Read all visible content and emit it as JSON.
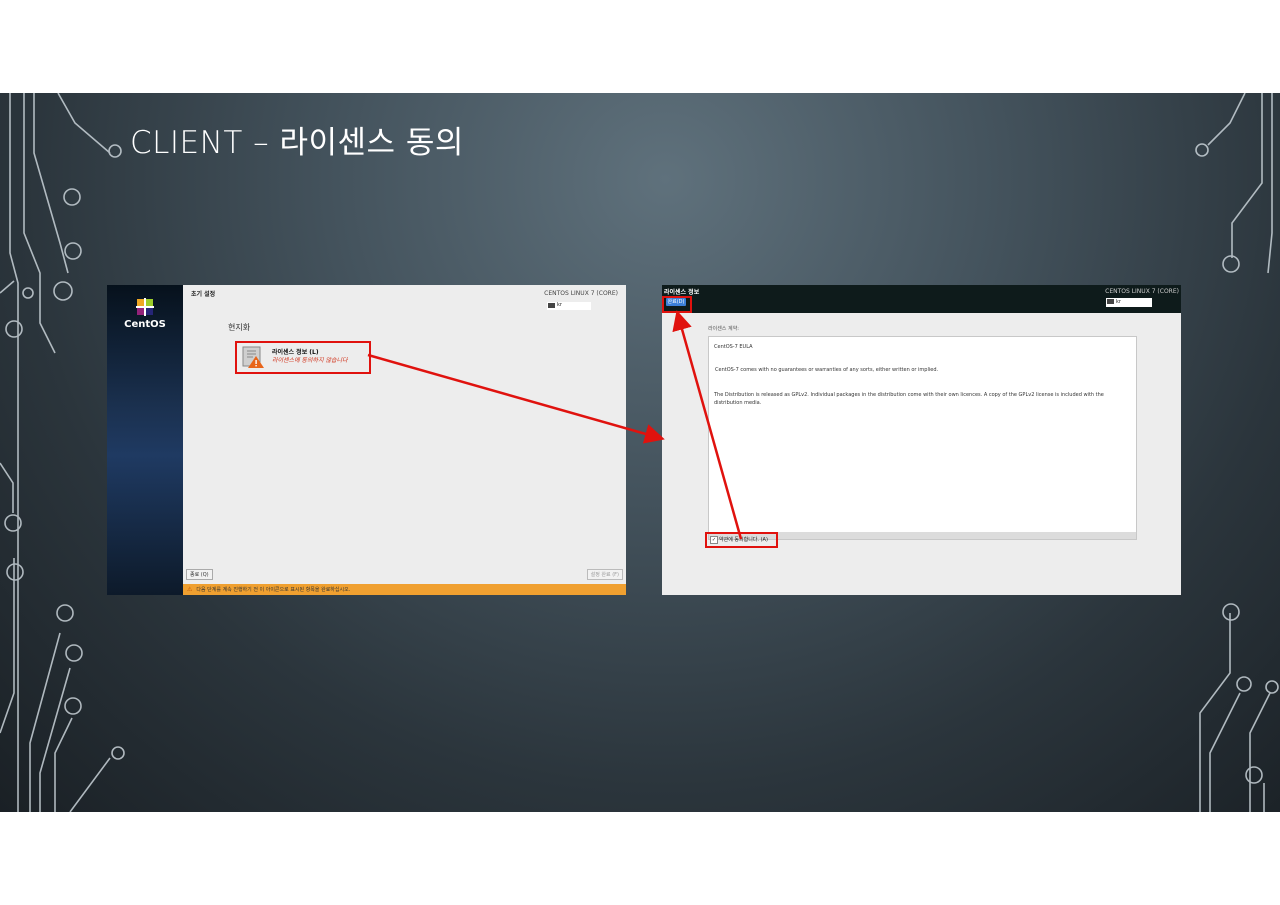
{
  "slide": {
    "title": "CLIENT – 라이센스 동의"
  },
  "left_screen": {
    "header_title": "초기 설정",
    "product": "CENTOS LINUX 7 (CORE)",
    "keyboard": "kr",
    "logo_text": "CentOS",
    "section_title": "현지화",
    "spoke_title": "라이센스 정보 (L)",
    "spoke_status": "라이센스에 동의하지 않습니다",
    "quit_button": "종료 (Q)",
    "finish_button": "설정 완료 (F)",
    "warning_text": "다음 단계를 계속 진행하기 전 이 아이콘으로 표시된 항목을 완료하십시오."
  },
  "right_screen": {
    "header_title": "라이센스 정보",
    "done_button": "완료(D)",
    "product": "CENTOS LINUX 7 (CORE)",
    "keyboard": "kr",
    "agreement_label": "라이센스 계약:",
    "eula_title": "CentOS-7 EULA",
    "eula_p1": "CentOS-7 comes with no guarantees or warranties of any sorts, either written or implied.",
    "eula_p2": "The Distribution is released as GPLv2. Individual packages in the distribution come with their own licences. A copy of the GPLv2 license is included with the distribution media.",
    "agree_checkbox": "약관에 동의합니다. (A)",
    "agree_checked": true
  },
  "colors": {
    "highlight": "#e0120e",
    "warning_bar": "#f0a030",
    "done_button": "#3c7fd8"
  }
}
